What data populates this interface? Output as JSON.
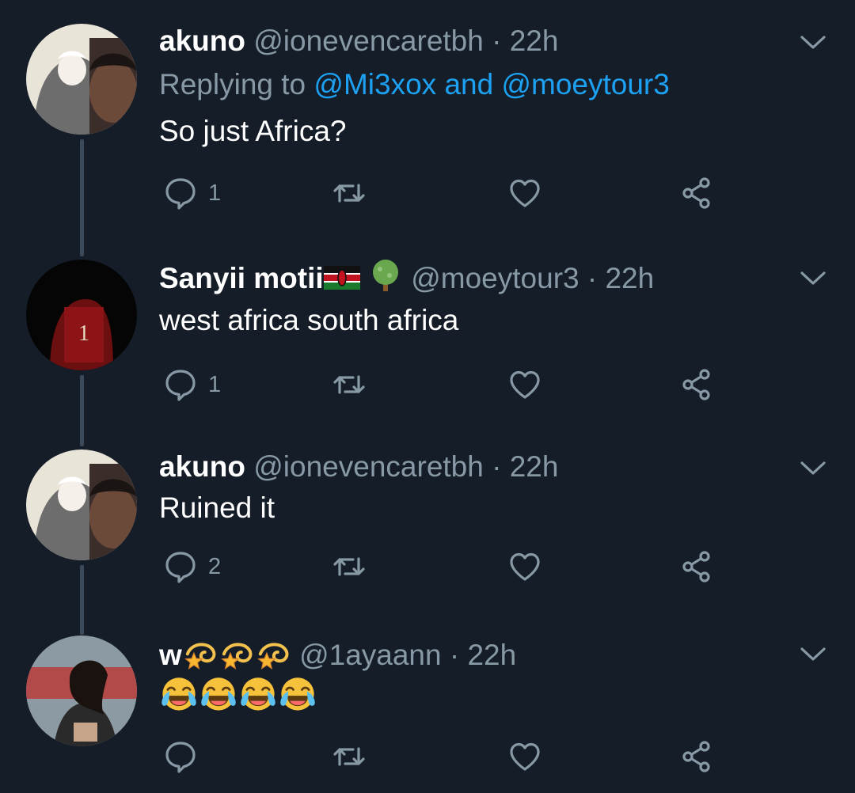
{
  "tweets": [
    {
      "name": "akuno",
      "handle": "@ionevencaretbh",
      "time": "22h",
      "reply_prefix": "Replying to",
      "reply_user1": "@Mi3xox",
      "reply_and": "and",
      "reply_user2": "@moeytour3",
      "text": "So just Africa?",
      "reply_count": "1"
    },
    {
      "name": "Sanyii motii",
      "name_emojis": [
        "kenya-flag",
        "tree"
      ],
      "handle": "@moeytour3",
      "time": "22h",
      "text": "west africa south africa",
      "reply_count": "1"
    },
    {
      "name": "akuno",
      "handle": "@ionevencaretbh",
      "time": "22h",
      "text": "Ruined it",
      "reply_count": "2"
    },
    {
      "name": "w",
      "name_emojis": [
        "dizzy-star",
        "dizzy-star",
        "dizzy-star"
      ],
      "handle": "@1ayaann",
      "time": "22h",
      "text_emojis": [
        "tears-of-joy",
        "tears-of-joy",
        "tears-of-joy",
        "tears-of-joy"
      ],
      "reply_count": ""
    }
  ],
  "separator": "·",
  "icons": [
    "reply-icon",
    "retweet-icon",
    "like-icon",
    "share-icon",
    "chevron-down-icon"
  ],
  "colors": {
    "background": "#151d28",
    "text_primary": "#ffffff",
    "text_secondary": "#8899a6",
    "link": "#1da1f2",
    "thread_line": "#3b4a5a"
  }
}
